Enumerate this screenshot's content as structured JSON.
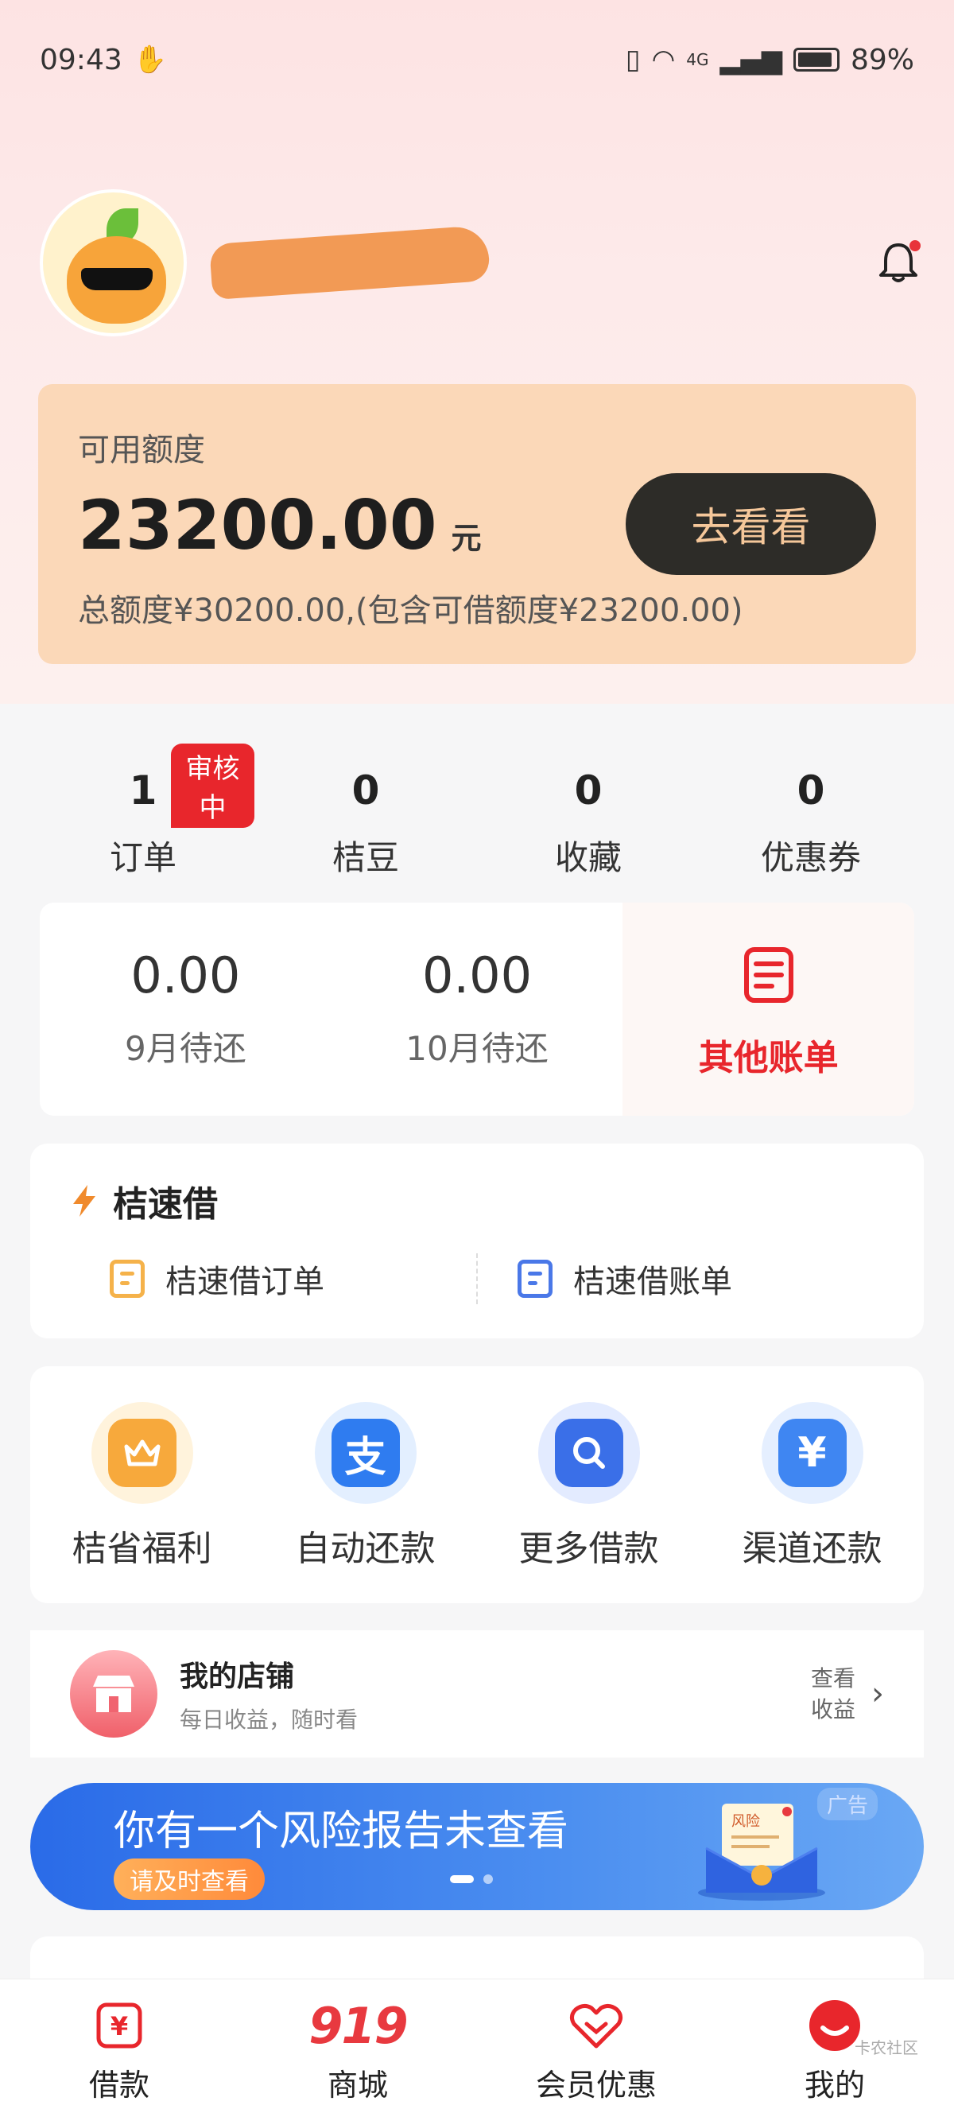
{
  "status_bar": {
    "time": "09:43",
    "network": "4G",
    "battery": "89%"
  },
  "credit": {
    "label": "可用额度",
    "amount": "23200.00",
    "unit": "元",
    "total_text": "总额度¥30200.00,(包含可借额度¥23200.00)",
    "button": "去看看"
  },
  "stats": [
    {
      "value": "1",
      "label": "订单",
      "badge": "审核中"
    },
    {
      "value": "0",
      "label": "桔豆"
    },
    {
      "value": "0",
      "label": "收藏"
    },
    {
      "value": "0",
      "label": "优惠券"
    }
  ],
  "bills": [
    {
      "amount": "0.00",
      "label": "9月待还"
    },
    {
      "amount": "0.00",
      "label": "10月待还"
    }
  ],
  "bills_other": "其他账单",
  "quick": {
    "title": "桔速借",
    "links": [
      "桔速借订单",
      "桔速借账单"
    ]
  },
  "services": [
    {
      "label": "桔省福利",
      "icon": "crown-icon",
      "color": "#f7a93c",
      "bg": "#fff3dc"
    },
    {
      "label": "自动还款",
      "icon": "alipay-icon",
      "color": "#2f7cf0",
      "bg": "#e3efff"
    },
    {
      "label": "更多借款",
      "icon": "search-icon",
      "color": "#3a6fe8",
      "bg": "#e3ebff"
    },
    {
      "label": "渠道还款",
      "icon": "yen-icon",
      "color": "#3f86f2",
      "bg": "#e5efff"
    }
  ],
  "shop": {
    "title": "我的店铺",
    "subtitle": "每日收益，随时看",
    "action_line1": "查看",
    "action_line2": "收益"
  },
  "banner": {
    "title": "你有一个风险报告未查看",
    "button": "请及时查看",
    "ad": "广告",
    "envelope_label": "风险"
  },
  "tabs": [
    {
      "label": "借款",
      "icon": "yen-tab-icon"
    },
    {
      "label": "商城",
      "icon": "919"
    },
    {
      "label": "会员优惠",
      "icon": "heart-tab-icon"
    },
    {
      "label": "我的",
      "icon": "profile-tab-icon"
    }
  ],
  "watermark": "卡农社区"
}
